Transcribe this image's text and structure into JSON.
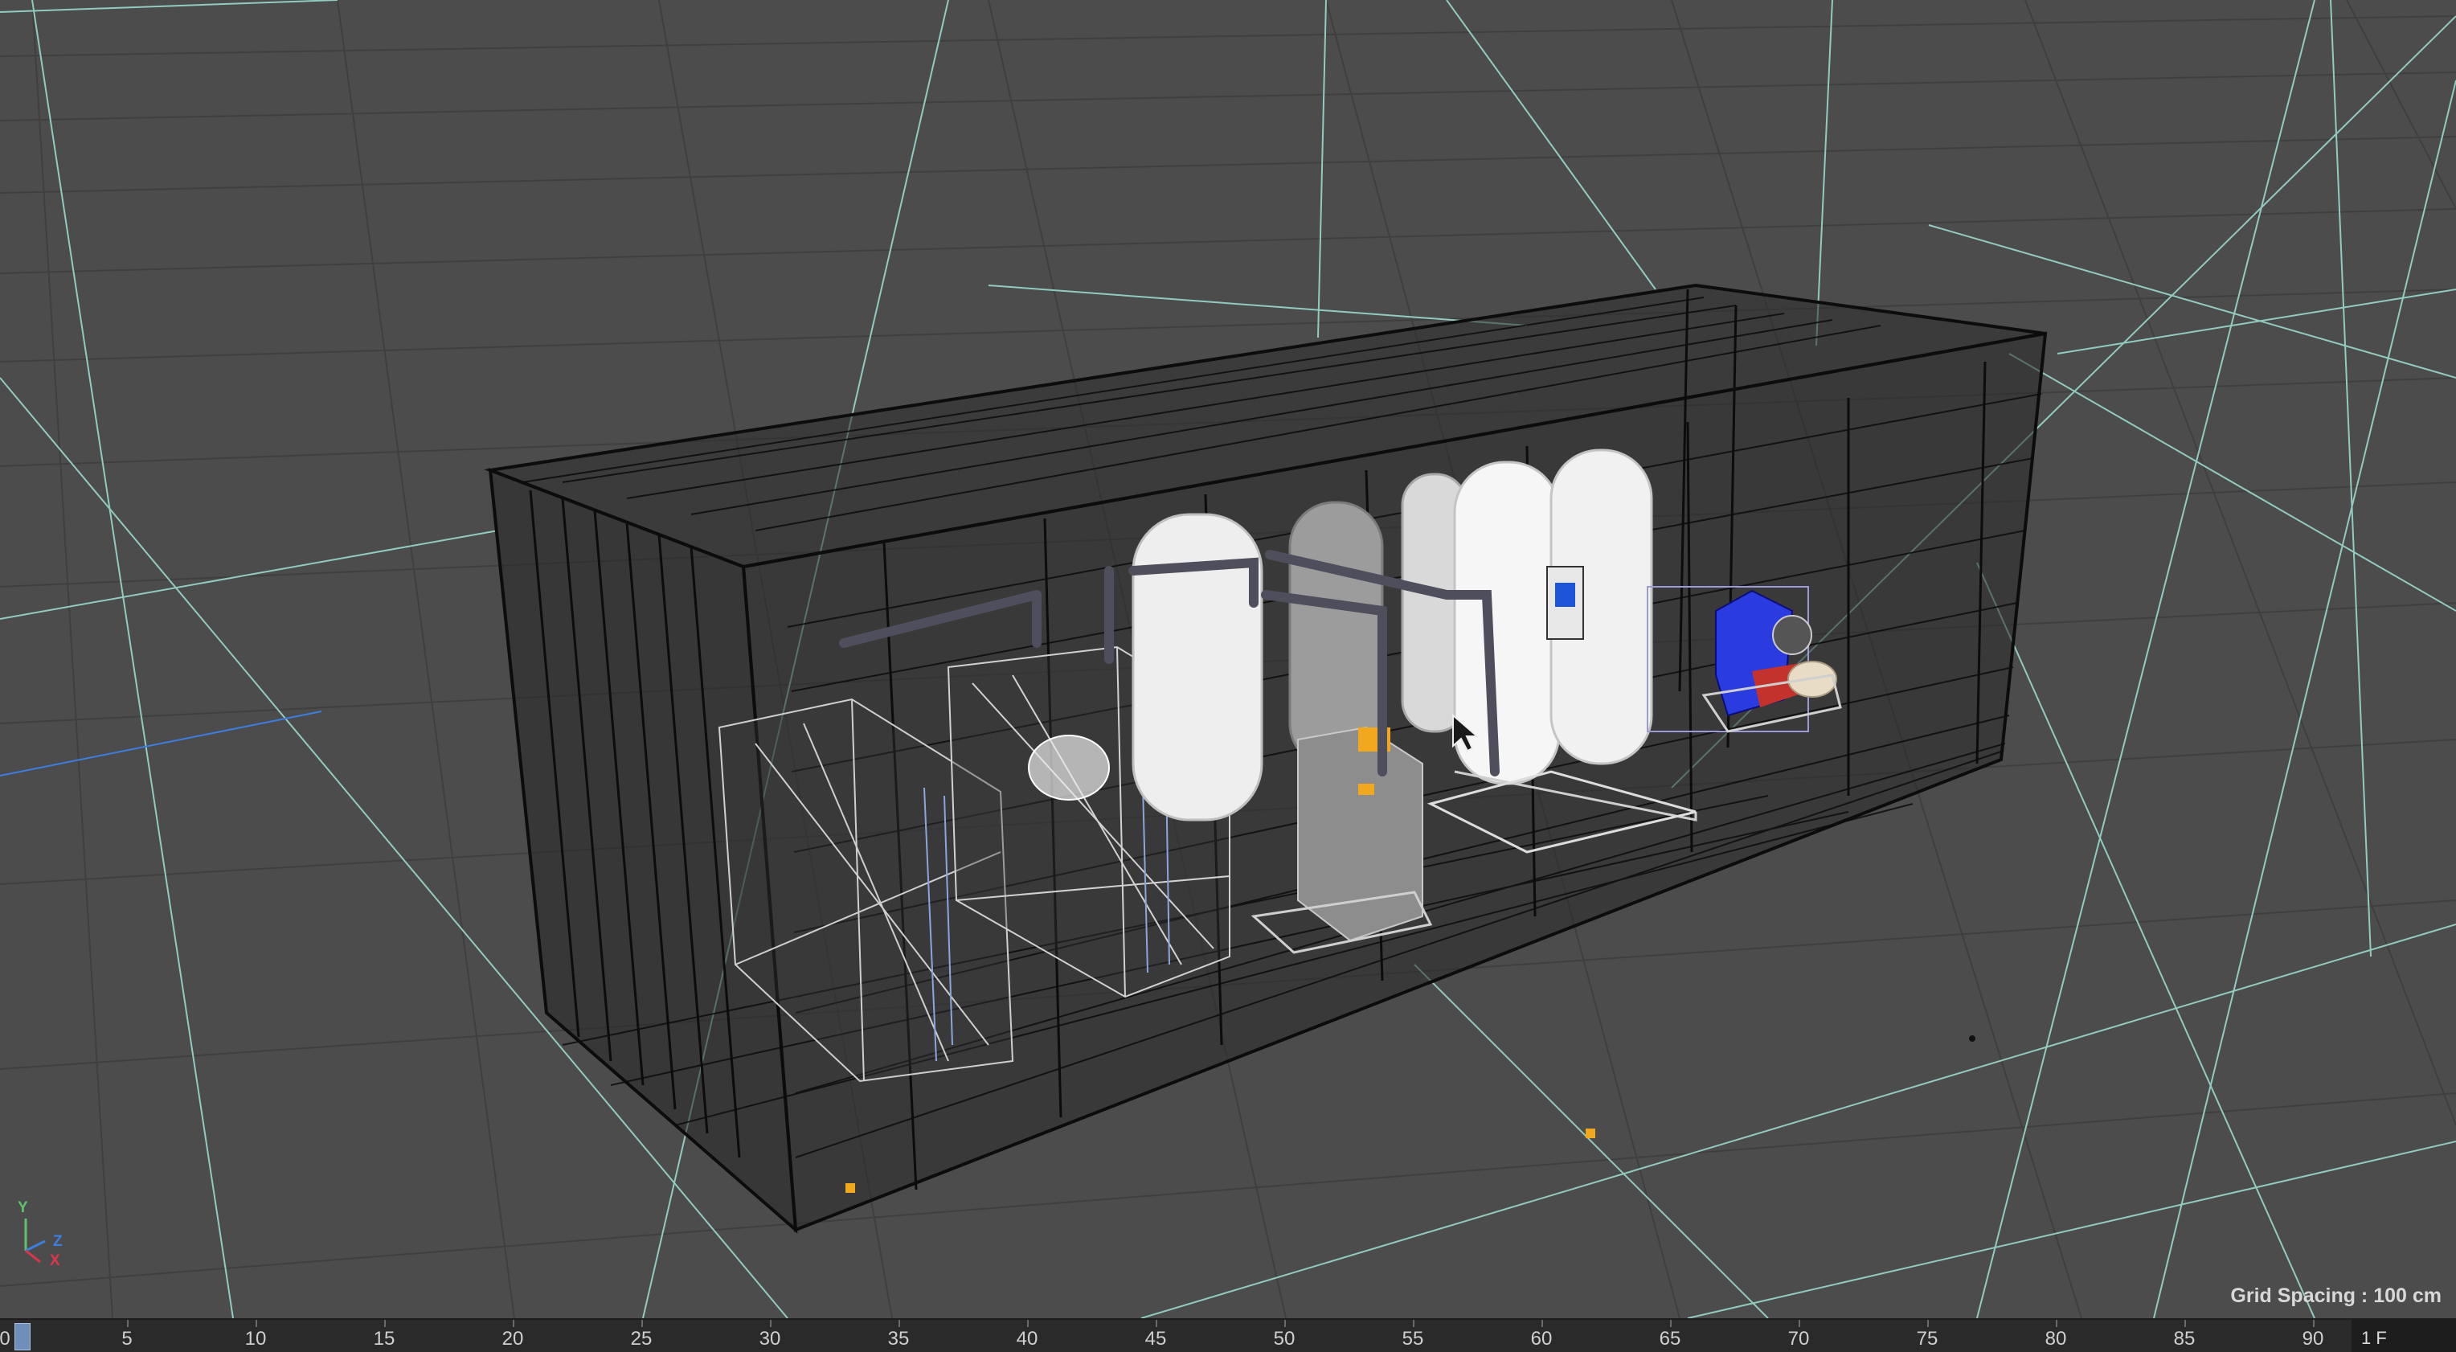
{
  "viewport": {
    "grid_spacing": "Grid Spacing : 100 cm",
    "axis_labels": {
      "y": "Y",
      "z": "Z",
      "x": "X"
    },
    "colors": {
      "background": "#4c4c4c",
      "grid_line": "#3f3f3f",
      "guide_line": "#9ad9cc",
      "wireframe": "#0c0c0c",
      "axis_x": "#e0344a",
      "axis_y": "#5ec26a",
      "axis_z": "#3d7ee0",
      "selection_point": "#f2a81e"
    },
    "scene_objects": [
      "container-wireframe",
      "rack-frame-left",
      "rack-frame-center",
      "vessel-white-1",
      "vessel-gray-2",
      "vessel-white-3",
      "vessel-white-4",
      "control-unit",
      "blue-pump-unit",
      "pipework"
    ]
  },
  "timeline": {
    "current_frame": "0",
    "ticks": [
      "5",
      "10",
      "15",
      "20",
      "25",
      "30",
      "35",
      "40",
      "45",
      "50",
      "55",
      "60",
      "65",
      "70",
      "75",
      "80",
      "85",
      "90"
    ],
    "end_frame": "1 F"
  }
}
